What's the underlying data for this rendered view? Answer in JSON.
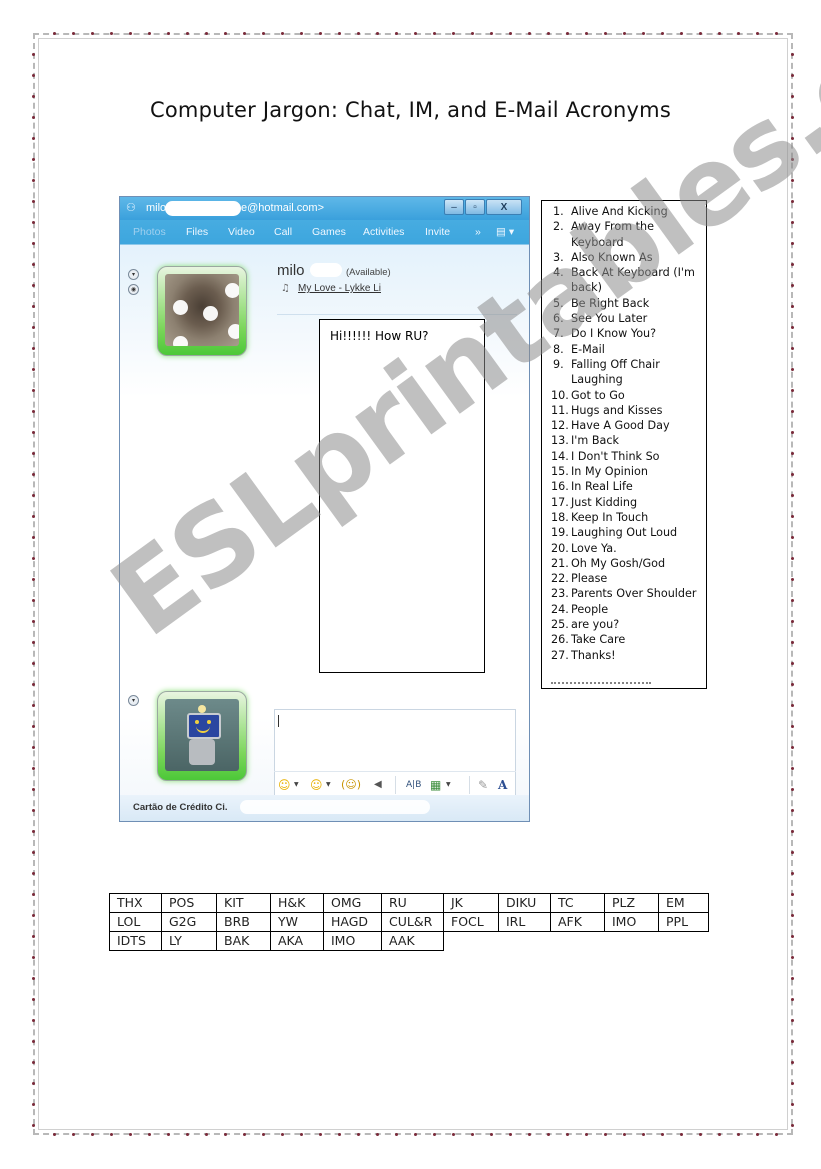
{
  "page": {
    "title": "Computer Jargon: Chat, IM, and E-Mail Acronyms",
    "watermark": "ESLprintables.com"
  },
  "messenger": {
    "titlebar": {
      "icon": "messenger-icon",
      "account_prefix": "milo",
      "account_suffix": "e@hotmail.com>",
      "minimize": "–",
      "maximize": "▫",
      "close": "X"
    },
    "menu": {
      "items": [
        "Photos",
        "Files",
        "Video",
        "Call",
        "Games",
        "Activities",
        "Invite"
      ],
      "more": "»",
      "options": "▤ ▾"
    },
    "contact": {
      "name": "milo",
      "status": "(Available)",
      "now_playing": "My Love - Lykke Li"
    },
    "conversation": {
      "message": "Hi!!!!!! How RU?"
    },
    "input": {
      "value": ""
    },
    "toolbar": {
      "emoticon": "☺",
      "wink": "☺",
      "nudge": "(☺)",
      "voice_clip": "◀",
      "font_label": "A|B",
      "background": "▦",
      "handwriting": "✎",
      "text_format": "A"
    },
    "status_bar": {
      "text": "Cartão de Crédito Ci."
    }
  },
  "meanings": [
    {
      "num": "1.",
      "text": "Alive And Kicking"
    },
    {
      "num": "2.",
      "text": "Away From the Keyboard"
    },
    {
      "num": "3.",
      "text": "Also Known As"
    },
    {
      "num": "4.",
      "text": "Back At Keyboard (I'm back)"
    },
    {
      "num": "5.",
      "text": "Be Right Back"
    },
    {
      "num": "6.",
      "text": "See You Later"
    },
    {
      "num": "7.",
      "text": "Do I Know You?"
    },
    {
      "num": "8.",
      "text": "E-Mail"
    },
    {
      "num": "9.",
      "text": "Falling Off Chair Laughing"
    },
    {
      "num": "10.",
      "text": "Got to Go"
    },
    {
      "num": "11.",
      "text": "Hugs and Kisses"
    },
    {
      "num": "12.",
      "text": "Have A Good Day"
    },
    {
      "num": "13.",
      "text": "I'm Back"
    },
    {
      "num": "14.",
      "text": "I Don't Think So"
    },
    {
      "num": "15.",
      "text": "In My Opinion"
    },
    {
      "num": "16.",
      "text": "In Real Life"
    },
    {
      "num": "17.",
      "text": "Just Kidding"
    },
    {
      "num": "18.",
      "text": "Keep In Touch"
    },
    {
      "num": "19.",
      "text": "Laughing Out Loud"
    },
    {
      "num": "20.",
      "text": "Love Ya."
    },
    {
      "num": "21.",
      "text": "Oh My Gosh/God"
    },
    {
      "num": "22.",
      "text": "Please"
    },
    {
      "num": "23.",
      "text": "Parents Over Shoulder"
    },
    {
      "num": "24.",
      "text": "People"
    },
    {
      "num": "25.",
      "text": "are you?"
    },
    {
      "num": "26.",
      "text": "Take Care"
    },
    {
      "num": "27.",
      "text": "Thanks!"
    }
  ],
  "acronyms": [
    [
      "THX",
      "POS",
      "KIT",
      "H&K",
      "OMG",
      "RU",
      "JK",
      "DIKU",
      "TC",
      "PLZ",
      "EM"
    ],
    [
      "LOL",
      "G2G",
      "BRB",
      "YW",
      "HAGD",
      "CUL&R",
      "FOCL",
      "IRL",
      "AFK",
      "IMO",
      "PPL"
    ],
    [
      "IDTS",
      "LY",
      "BAK",
      "AKA",
      "IMO",
      "AAK"
    ]
  ]
}
